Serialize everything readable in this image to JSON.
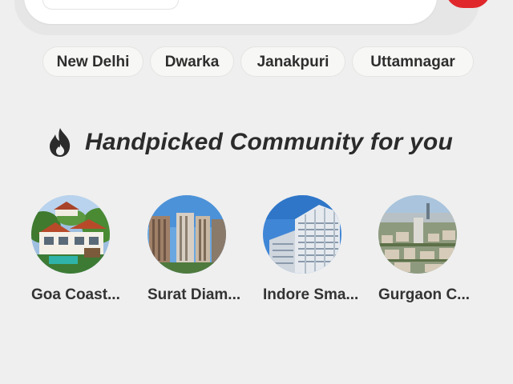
{
  "chips": [
    "New Delhi",
    "Dwarka",
    "Janakpuri",
    "Uttamnagar"
  ],
  "section": {
    "title": "Handpicked Community for you",
    "icon": "flame-icon"
  },
  "communities": [
    {
      "name": "Goa Coast..."
    },
    {
      "name": "Surat Diam..."
    },
    {
      "name": "Indore Sma..."
    },
    {
      "name": "Gurgaon C..."
    }
  ],
  "colors": {
    "background": "#efefef",
    "accent_red": "#e0282c",
    "chip_background": "#f7f7f5",
    "text": "#2b2b2b"
  }
}
